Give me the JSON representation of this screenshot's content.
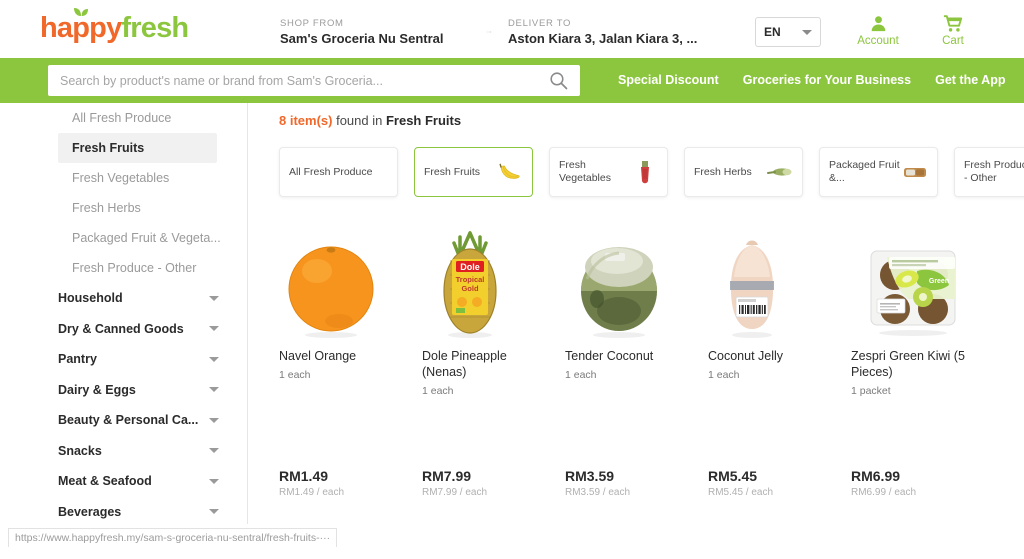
{
  "header": {
    "logo": {
      "part1": "happy",
      "part2": "fresh",
      "leaf_icon": "leaf-icon"
    },
    "shop_from": {
      "label": "SHOP FROM",
      "value": "Sam's Groceria Nu Sentral"
    },
    "deliver_to": {
      "label": "DELIVER TO",
      "value": "Aston Kiara 3, Jalan Kiara 3, ..."
    },
    "arrow_icon": "arrow-right-icon",
    "language": {
      "value": "EN",
      "caret_icon": "chevron-down-icon"
    },
    "account": {
      "label": "Account",
      "icon": "person-icon"
    },
    "cart": {
      "label": "Cart",
      "icon": "shopping-cart-icon"
    }
  },
  "search": {
    "placeholder": "Search by product's name or brand from Sam's Groceria...",
    "value": "",
    "icon": "search-icon"
  },
  "nav_links": [
    {
      "label": "Special Discount"
    },
    {
      "label": "Groceries for Your Business"
    },
    {
      "label": "Get the App"
    }
  ],
  "sidebar": {
    "subitems": [
      {
        "label": "All Fresh Produce",
        "active": false
      },
      {
        "label": "Fresh Fruits",
        "active": true
      },
      {
        "label": "Fresh Vegetables",
        "active": false
      },
      {
        "label": "Fresh Herbs",
        "active": false
      },
      {
        "label": "Packaged Fruit & Vegeta...",
        "active": false
      },
      {
        "label": "Fresh Produce - Other",
        "active": false
      }
    ],
    "topitems": [
      {
        "label": "Household"
      },
      {
        "label": "Dry & Canned Goods"
      },
      {
        "label": "Pantry"
      },
      {
        "label": "Dairy & Eggs"
      },
      {
        "label": "Beauty & Personal Ca..."
      },
      {
        "label": "Snacks"
      },
      {
        "label": "Meat & Seafood"
      },
      {
        "label": "Beverages"
      }
    ]
  },
  "main": {
    "results": {
      "count": "8 item(s)",
      "middle": " found in ",
      "category": "Fresh Fruits"
    },
    "chips": [
      {
        "label": "All Fresh Produce",
        "icon": "none",
        "active": false
      },
      {
        "label": "Fresh Fruits",
        "icon": "banana-icon",
        "active": true
      },
      {
        "label": "Fresh Vegetables",
        "icon": "radish-icon",
        "active": false
      },
      {
        "label": "Fresh Herbs",
        "icon": "herb-icon",
        "active": false
      },
      {
        "label": "Packaged Fruit &...",
        "icon": "package-icon",
        "active": false
      },
      {
        "label": "Fresh Produce - Other",
        "icon": "greenbag-icon",
        "active": false
      }
    ],
    "products": [
      {
        "name": "Navel Orange",
        "unit": "1 each",
        "price": "RM1.49",
        "price_sub": "RM1.49 / each",
        "image": "orange-image"
      },
      {
        "name": "Dole Pineapple (Nenas)",
        "unit": "1 each",
        "price": "RM7.99",
        "price_sub": "RM7.99 / each",
        "image": "pineapple-image"
      },
      {
        "name": "Tender Coconut",
        "unit": "1 each",
        "price": "RM3.59",
        "price_sub": "RM3.59 / each",
        "image": "coconut-image"
      },
      {
        "name": "Coconut Jelly",
        "unit": "1 each",
        "price": "RM5.45",
        "price_sub": "RM5.45 / each",
        "image": "coconut-jelly-image"
      },
      {
        "name": "Zespri Green Kiwi (5 Pieces)",
        "unit": "1 packet",
        "price": "RM6.99",
        "price_sub": "RM6.99 / each",
        "image": "kiwi-pack-image"
      }
    ]
  },
  "status_bar": {
    "url": "https://www.happyfresh.my/sam-s-groceria-nu-sentral/fresh-fruits-···"
  },
  "colors": {
    "brand_green": "#8cc63e",
    "brand_orange": "#f0682a",
    "text_dark": "#2b2b2b",
    "text_muted": "#9a9a9a"
  }
}
